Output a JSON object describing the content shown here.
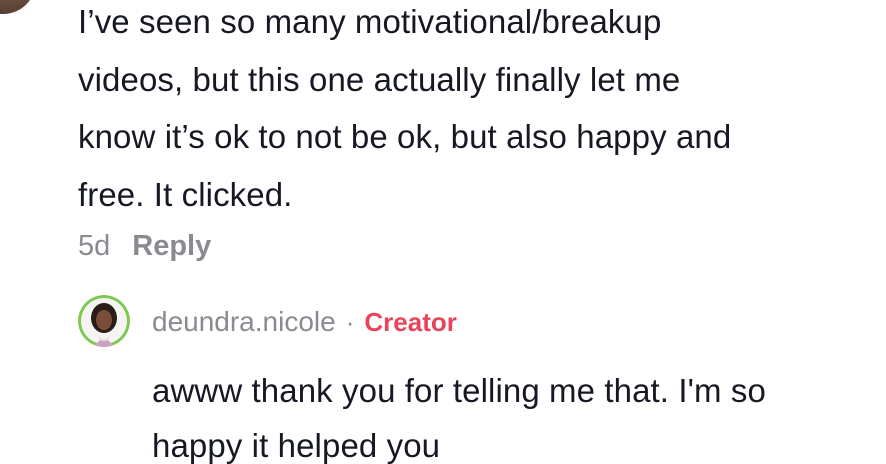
{
  "comment": {
    "lines": [
      "I’ve seen so many motivational/breakup",
      "videos, but this one actually finally let me",
      "know it’s ok to not be ok, but also happy and",
      "free. It clicked."
    ],
    "time": "5d",
    "reply_label": "Reply"
  },
  "reply": {
    "author": "deundra.nicole",
    "separator": "·",
    "badge": "Creator",
    "lines": [
      "awww thank you for telling me that. I'm so",
      "happy it helped you"
    ]
  },
  "colors": {
    "text": "#161823",
    "muted": "#8a8b91",
    "creator_badge": "#e8445a",
    "avatar_ring": "#7ec850"
  }
}
